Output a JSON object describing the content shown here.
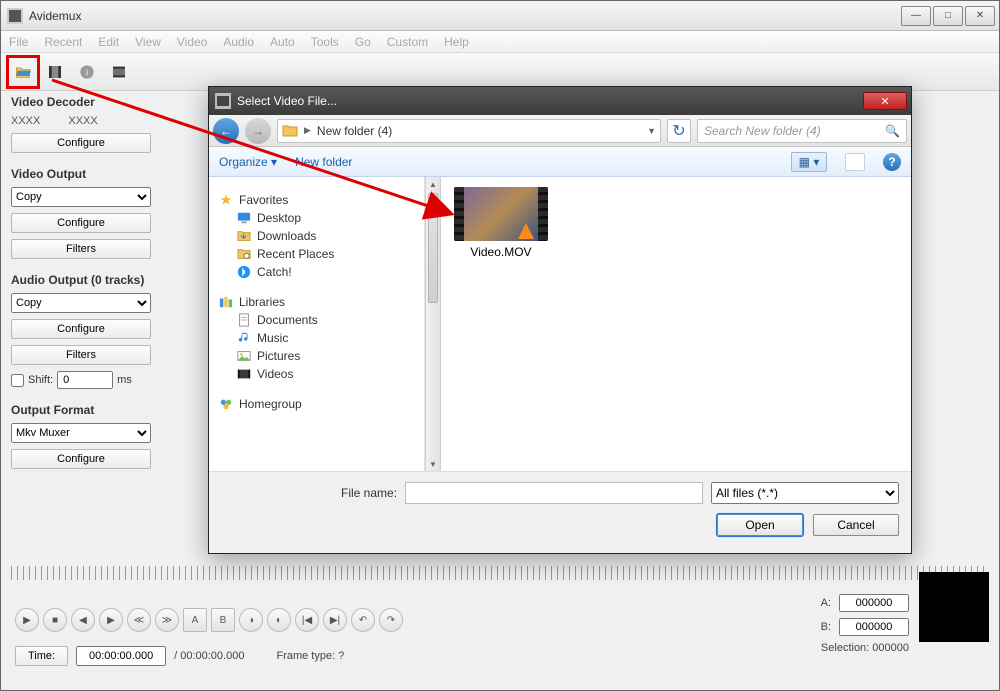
{
  "window": {
    "title": "Avidemux",
    "buttons": {
      "min": "—",
      "max": "□",
      "close": "✕"
    }
  },
  "menu": [
    "File",
    "Recent",
    "Edit",
    "View",
    "Video",
    "Audio",
    "Auto",
    "Tools",
    "Go",
    "Custom",
    "Help"
  ],
  "sidebar": {
    "decoder_label": "Video Decoder",
    "xxxx": "XXXX",
    "configure": "Configure",
    "video_output_label": "Video Output",
    "video_output_value": "Copy",
    "filters": "Filters",
    "audio_output_label": "Audio Output (0 tracks)",
    "audio_output_value": "Copy",
    "shift_label": "Shift:",
    "shift_value": "0",
    "shift_unit": "ms",
    "output_format_label": "Output Format",
    "output_format_value": "Mkv Muxer"
  },
  "bottom": {
    "time_label": "Time:",
    "time_value": "00:00:00.000",
    "time_total": "/ 00:00:00.000",
    "frame_type": "Frame type:  ?",
    "A_label": "A:",
    "A_val": "000000",
    "B_label": "B:",
    "B_val": "000000",
    "selection": "Selection: 000000"
  },
  "dialog": {
    "title": "Select Video File...",
    "breadcrumb": "New folder (4)",
    "search_placeholder": "Search New folder (4)",
    "organize": "Organize",
    "newfolder": "New folder",
    "nav": {
      "favorites": "Favorites",
      "desktop": "Desktop",
      "downloads": "Downloads",
      "recent": "Recent Places",
      "catch": "Catch!",
      "libraries": "Libraries",
      "documents": "Documents",
      "music": "Music",
      "pictures": "Pictures",
      "videos": "Videos",
      "homegroup": "Homegroup"
    },
    "file_item": "Video.MOV",
    "filename_label": "File name:",
    "filename_value": "",
    "filter_value": "All files (*.*)",
    "open": "Open",
    "cancel": "Cancel"
  }
}
